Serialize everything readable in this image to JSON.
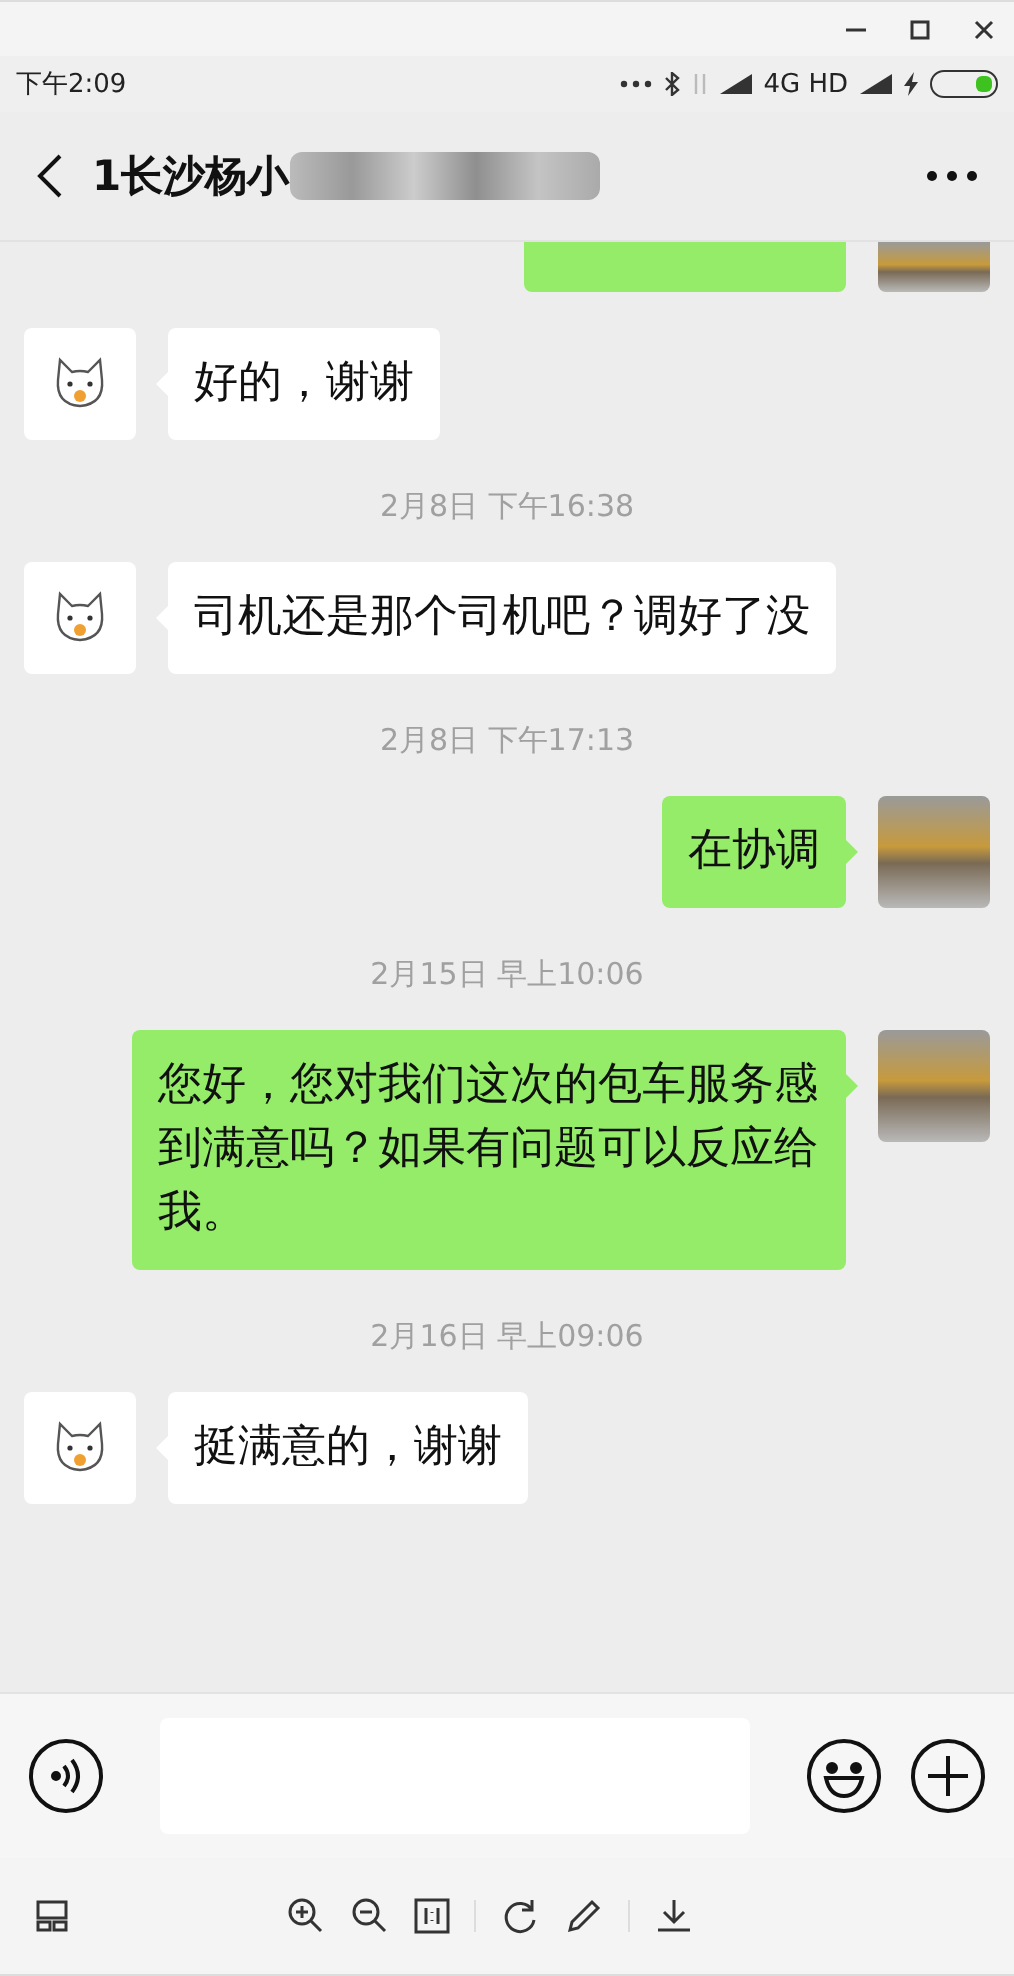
{
  "status_bar": {
    "time": "下午2:09",
    "network": "4G HD"
  },
  "header": {
    "title": "1长沙杨小",
    "redacted": true
  },
  "messages": [
    {
      "kind": "outgoing_cut"
    },
    {
      "kind": "incoming",
      "text": "好的，谢谢"
    },
    {
      "kind": "time",
      "text": "2月8日 下午16:38"
    },
    {
      "kind": "incoming",
      "text": "司机还是那个司机吧？调好了没"
    },
    {
      "kind": "time",
      "text": "2月8日 下午17:13"
    },
    {
      "kind": "outgoing",
      "text": "在协调"
    },
    {
      "kind": "time",
      "text": "2月15日 早上10:06"
    },
    {
      "kind": "outgoing",
      "text": "您好，您对我们这次的包车服务感到满意吗？如果有问题可以反应给我。"
    },
    {
      "kind": "time",
      "text": "2月16日 早上09:06"
    },
    {
      "kind": "incoming",
      "text": "挺满意的，谢谢"
    }
  ]
}
